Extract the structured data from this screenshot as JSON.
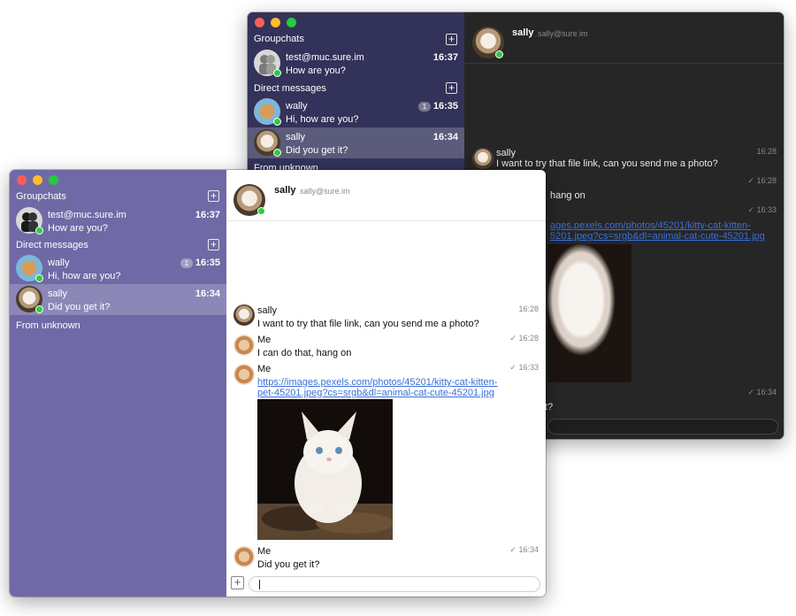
{
  "sidebar": {
    "groupchats_label": "Groupchats",
    "direct_label": "Direct messages",
    "unknown_label": "From unknown",
    "groupchat": {
      "name": "test@muc.sure.im",
      "preview": "How are you?",
      "time": "16:37"
    },
    "direct": [
      {
        "name": "wally",
        "preview": "Hi, how are you?",
        "time": "16:35",
        "unread": "1"
      },
      {
        "name": "sally",
        "preview": "Did you get it?",
        "time": "16:34",
        "unread": ""
      }
    ]
  },
  "header": {
    "name": "sally",
    "jid": "sally@sure.im"
  },
  "messages": [
    {
      "sender": "sally",
      "text": "I want to try that file link, can you send me a photo?",
      "time": "16:28"
    },
    {
      "sender": "Me",
      "text": "I can do that, hang on",
      "time": "✓ 16:28"
    },
    {
      "sender": "Me",
      "link_line1": "https://images.pexels.com/photos/45201/kitty-cat-kitten-",
      "link_line2": "pet-45201.jpeg?cs=srgb&dl=animal-cat-cute-45201.jpg",
      "time": "✓ 16:33"
    },
    {
      "sender": "Me",
      "text": "Did you get it?",
      "time": "✓ 16:34"
    }
  ],
  "dark": {
    "frag_hang": "hang on",
    "frag_link1": "ages.pexels.com/photos/45201/kitty-cat-kitten-",
    "frag_link2": "5201.jpeg?cs=srgb&dl=animal-cat-cute-45201.jpg",
    "frag_q": "t?"
  },
  "icons": {
    "plus": "+"
  },
  "colors": {
    "accent_light": "#6f6aa6",
    "accent_dark": "#33325a",
    "online": "#2ecc40",
    "link": "#3a6fd8"
  }
}
